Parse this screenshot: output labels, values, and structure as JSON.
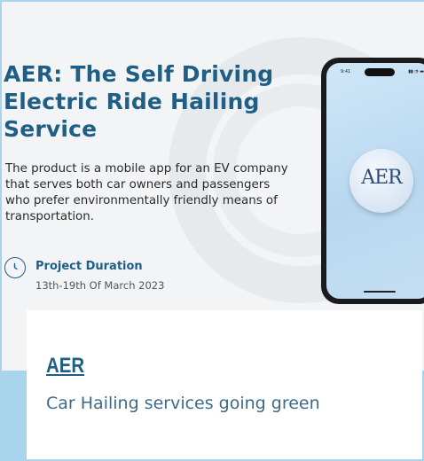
{
  "hero": {
    "title": "AER:  The Self Driving Electric Ride Hailing Service",
    "description": "The product is a mobile app for an EV company that serves both car owners and passengers who prefer environmentally friendly means of transportation.",
    "duration_label": "Project Duration",
    "duration_value": "13th-19th Of March 2023",
    "duration_icon": "clock-icon"
  },
  "phone": {
    "status_time": "9:41",
    "status_icons": "▮▮ ◔ ▬",
    "logo_text": "AER"
  },
  "card": {
    "title": "AER",
    "subtitle": "Car Hailing services going green"
  },
  "colors": {
    "accent": "#1f5f86",
    "page_bg": "#a8d4ec",
    "hero_bg": "#f3f4f6"
  }
}
